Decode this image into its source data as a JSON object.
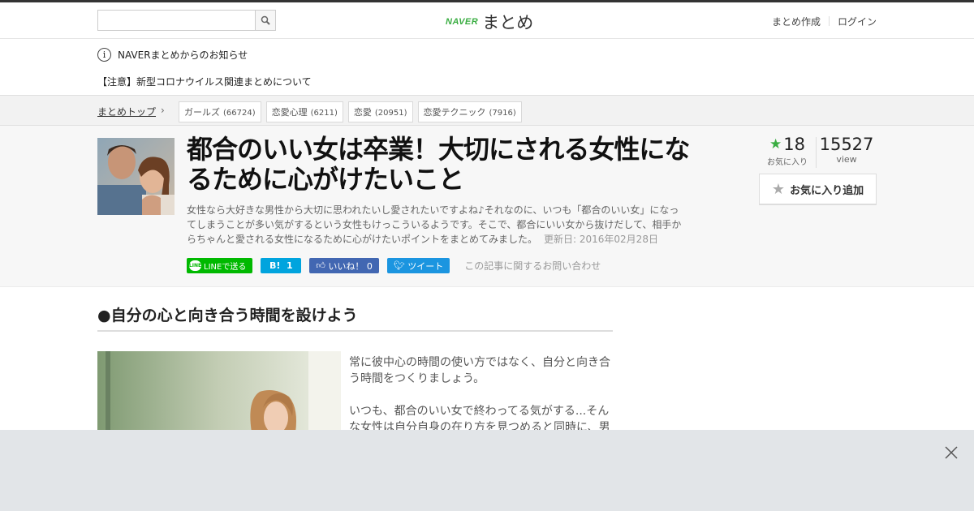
{
  "header": {
    "search": {
      "placeholder": "",
      "value": ""
    },
    "logo": {
      "naver": "NAVER",
      "matome": "まとめ"
    },
    "nav": [
      "まとめ作成",
      "ログイン"
    ]
  },
  "notice": {
    "heading": "NAVERまとめからのお知らせ",
    "item": "【注意】新型コロナウイルス関連まとめについて"
  },
  "breadcrumb": {
    "top": "まとめトップ",
    "tags": [
      {
        "label": "ガールズ",
        "count": "(66724)"
      },
      {
        "label": "恋愛心理",
        "count": "(6211)"
      },
      {
        "label": "恋愛",
        "count": "(20951)"
      },
      {
        "label": "恋愛テクニック",
        "count": "(7916)"
      }
    ]
  },
  "article": {
    "title": "都合のいい女は卒業！大切にされる女性になるために心がけたいこと",
    "description": "女性なら大好きな男性から大切に思われたいし愛されたいですよね♪それなのに、いつも「都合のいい女」になってしまうことが多い気がするという女性もけっこういるようです。そこで、都合にいい女から抜けだして、相手からちゃんと愛される女性になるために心がけたいポイントをまとめてみました。",
    "updated": "更新日: 2016年02月28日",
    "favorites": {
      "count": "18",
      "label": "お気に入り"
    },
    "views": {
      "count": "15527",
      "label": "view"
    },
    "fav_button": "お気に入り追加",
    "share": {
      "line": "LINEで送る",
      "hatena": "1",
      "facebook": "いいね！ 0",
      "twitter": "ツイート",
      "inquiry": "この記事に関するお問い合わせ"
    }
  },
  "content": {
    "section_heading": "●自分の心と向き合う時間を設けよう",
    "paragraphs": [
      "常に彼中心の時間の使い方ではなく、自分と向き合う時間をつくりましょう。",
      "いつも、都合のいい女で終わってる気がする...そんな女性は自分自身の在り方を見つめると同時に、男"
    ]
  },
  "colors": {
    "naver_green": "#3aad42",
    "line_green": "#00b900",
    "hatena_blue": "#00a4de",
    "facebook_blue": "#4267b2",
    "twitter_blue": "#1b95e0",
    "overlay_bg": "#e2e5e8"
  },
  "icons": {
    "search": "search-icon",
    "info": "info-icon",
    "chevron": "chevron-right-icon",
    "star": "star-icon",
    "close": "close-icon"
  }
}
